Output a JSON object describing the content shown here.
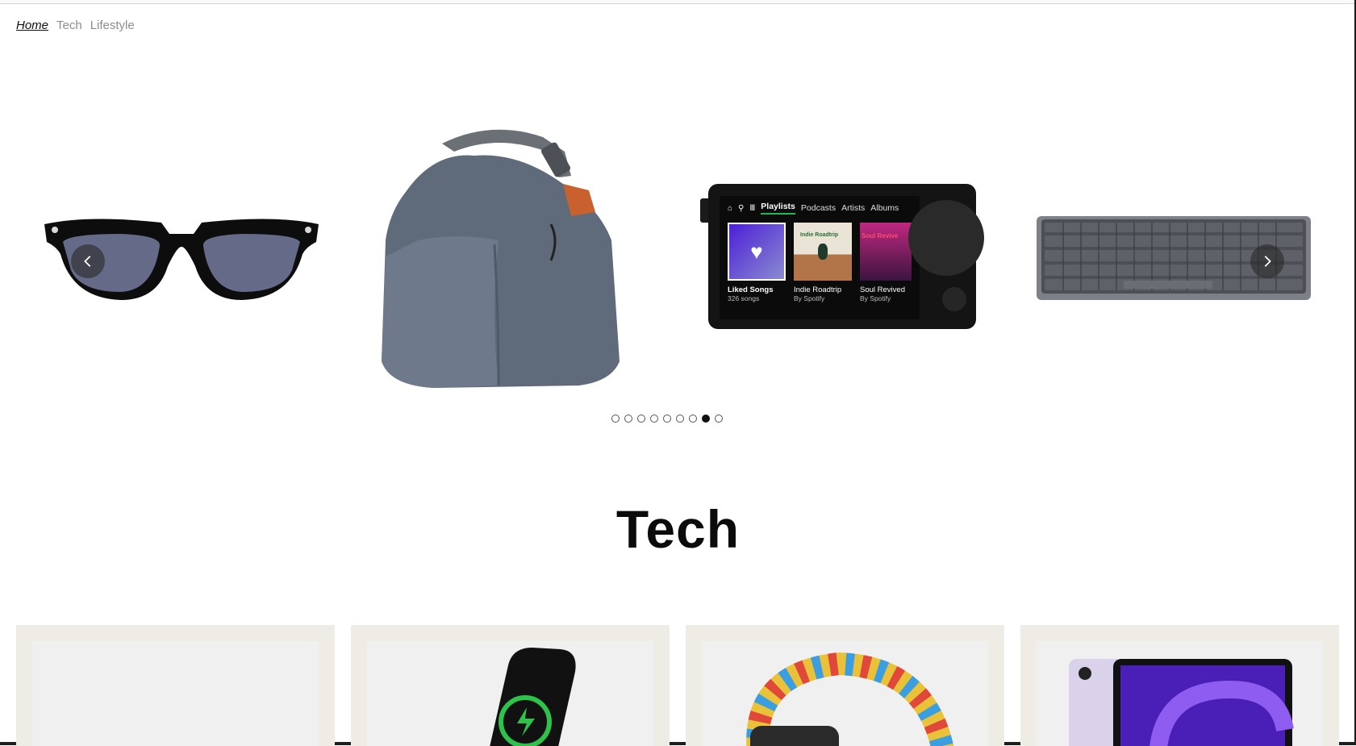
{
  "nav": {
    "items": [
      "Home",
      "Tech",
      "Lifestyle"
    ],
    "active": "Home"
  },
  "carousel": {
    "slides": [
      "sunglasses",
      "roll-top bag",
      "spotify car thing",
      "keyboard"
    ],
    "dot_count": 9,
    "active_dot": 8,
    "player": {
      "tabs": [
        "Playlists",
        "Podcasts",
        "Artists",
        "Albums"
      ],
      "active_tab": "Playlists",
      "brand": "Spotify",
      "tiles": [
        {
          "title": "Liked Songs",
          "subtitle": "326 songs",
          "art_text": ""
        },
        {
          "title": "Indie Roadtrip",
          "subtitle": "By Spotify",
          "art_text": "Indie Roadtrip"
        },
        {
          "title": "Soul Revived",
          "subtitle": "By Spotify",
          "art_text": "Soul Revive"
        }
      ]
    }
  },
  "section": {
    "title": "Tech"
  },
  "products": [
    "blank",
    "magsafe charger phone",
    "pride braided loop watch",
    "ipad air purple"
  ],
  "colors": {
    "accent": "#111111",
    "card_bg": "#efece6",
    "spotify_green": "#1db954"
  }
}
